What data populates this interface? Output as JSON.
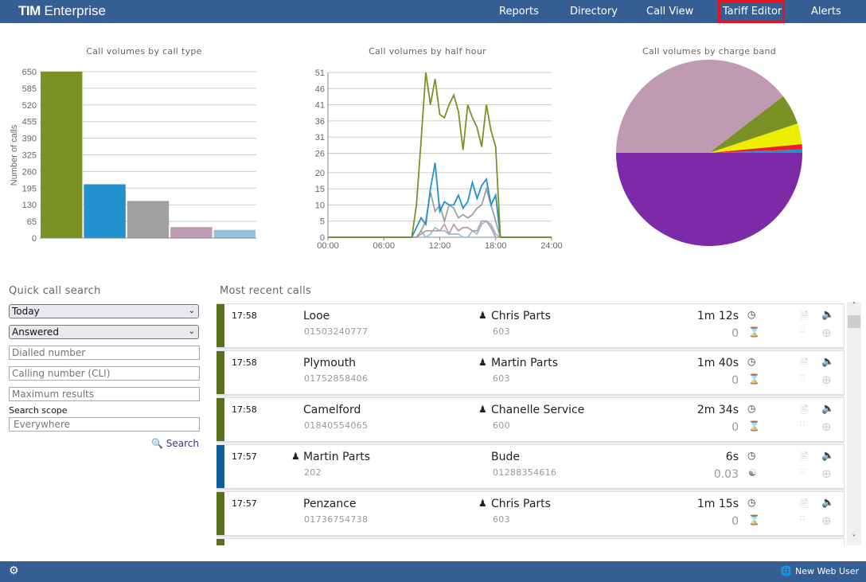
{
  "header": {
    "logo_bold": "TIM",
    "logo_rest": "Enterprise",
    "nav": [
      {
        "label": "Reports"
      },
      {
        "label": "Directory"
      },
      {
        "label": "Call View"
      },
      {
        "label": "Tariff Editor",
        "active": true
      },
      {
        "label": "Alerts"
      }
    ],
    "active_outline_color": "#e3141f"
  },
  "chart_data": [
    {
      "type": "bar",
      "title": "Call volumes by call type",
      "ylabel": "Number of calls",
      "ylim": [
        0,
        650
      ],
      "yticks": [
        0,
        65,
        130,
        195,
        260,
        325,
        390,
        455,
        520,
        585,
        650
      ],
      "values": [
        650,
        210,
        145,
        43,
        32
      ],
      "colors": [
        "#7a9126",
        "#2391cd",
        "#a0a0a0",
        "#c09ab2",
        "#94c3dc"
      ],
      "grid": true
    },
    {
      "type": "line",
      "title": "Call volumes by half hour",
      "xlim": [
        "00:00",
        "24:00"
      ],
      "xticks": [
        "00:00",
        "06:00",
        "12:00",
        "18:00",
        "24:00"
      ],
      "ylim": [
        0,
        51
      ],
      "yticks": [
        0,
        5,
        10,
        15,
        20,
        26,
        31,
        36,
        41,
        46,
        51
      ],
      "grid": true,
      "x": [
        "09:00",
        "09:30",
        "10:00",
        "10:30",
        "11:00",
        "11:30",
        "12:00",
        "12:30",
        "13:00",
        "13:30",
        "14:00",
        "14:30",
        "15:00",
        "15:30",
        "16:00",
        "16:30",
        "17:00",
        "17:30",
        "18:00",
        "18:30"
      ],
      "series": [
        {
          "color": "#7a9126",
          "values": [
            0,
            10,
            30,
            51,
            41,
            49,
            38,
            37,
            41,
            44,
            39,
            27,
            41,
            37,
            34,
            28,
            41,
            33,
            28,
            0
          ]
        },
        {
          "color": "#2391cd",
          "values": [
            0,
            3,
            6,
            4,
            15,
            23,
            8,
            11,
            10,
            10,
            13,
            9,
            11,
            17,
            12,
            16,
            18,
            10,
            13,
            0
          ]
        },
        {
          "color": "#a0a0a0",
          "values": [
            0,
            0,
            2,
            5,
            14,
            8,
            10,
            5,
            10,
            9,
            6,
            7,
            6,
            7,
            9,
            10,
            15,
            10,
            5,
            0
          ]
        },
        {
          "color": "#c09ab2",
          "values": [
            0,
            0,
            1,
            2,
            2,
            2,
            2,
            4,
            1,
            4,
            2,
            3,
            3,
            2,
            2,
            5,
            5,
            3,
            0,
            0
          ]
        },
        {
          "color": "#94c3dc",
          "values": [
            0,
            0,
            2,
            0,
            1,
            3,
            2,
            2,
            1,
            1,
            1,
            0,
            0,
            2,
            1,
            4,
            5,
            4,
            1,
            0
          ]
        }
      ]
    },
    {
      "type": "pie",
      "title": "Call volumes by charge band",
      "values": [
        0.6,
        0.9,
        3.6,
        5.3,
        39.6,
        50.0
      ],
      "colors": [
        "#2391cd",
        "#ee1c24",
        "#eeee00",
        "#7a9126",
        "#c09ab2",
        "#7d2aa8"
      ]
    }
  ],
  "search": {
    "title": "Quick call search",
    "period": "Today",
    "status": "Answered",
    "dialled_placeholder": "Dialled number",
    "cli_placeholder": "Calling number (CLI)",
    "max_placeholder": "Maximum results",
    "scope_label": "Search scope",
    "scope_value": "Everywhere",
    "search_label": "Search"
  },
  "recent": {
    "title": "Most recent calls",
    "calls": [
      {
        "time": "17:58",
        "from": "Looe",
        "from_num": "01503240777",
        "to": "Chris Parts",
        "to_num": "603",
        "duration": "1m 12s",
        "cost": "0",
        "direction": "incoming",
        "color": "#5a701e"
      },
      {
        "time": "17:58",
        "from": "Plymouth",
        "from_num": "01752858406",
        "to": "Martin Parts",
        "to_num": "603",
        "duration": "1m 40s",
        "cost": "0",
        "direction": "incoming",
        "color": "#5a701e"
      },
      {
        "time": "17:58",
        "from": "Camelford",
        "from_num": "01840554065",
        "to": "Chanelle Service",
        "to_num": "600",
        "duration": "2m 34s",
        "cost": "0",
        "direction": "incoming",
        "color": "#5a701e"
      },
      {
        "time": "17:57",
        "from": "Martin Parts",
        "from_num": "202",
        "to": "Bude",
        "to_num": "01288354616",
        "duration": "6s",
        "cost": "0.03",
        "direction": "outgoing",
        "color": "#0b5f9a"
      },
      {
        "time": "17:57",
        "from": "Penzance",
        "from_num": "01736754738",
        "to": "Chris Parts",
        "to_num": "603",
        "duration": "1m 15s",
        "cost": "0",
        "direction": "incoming",
        "color": "#5a701e"
      }
    ]
  },
  "footer": {
    "user": "New Web User"
  }
}
